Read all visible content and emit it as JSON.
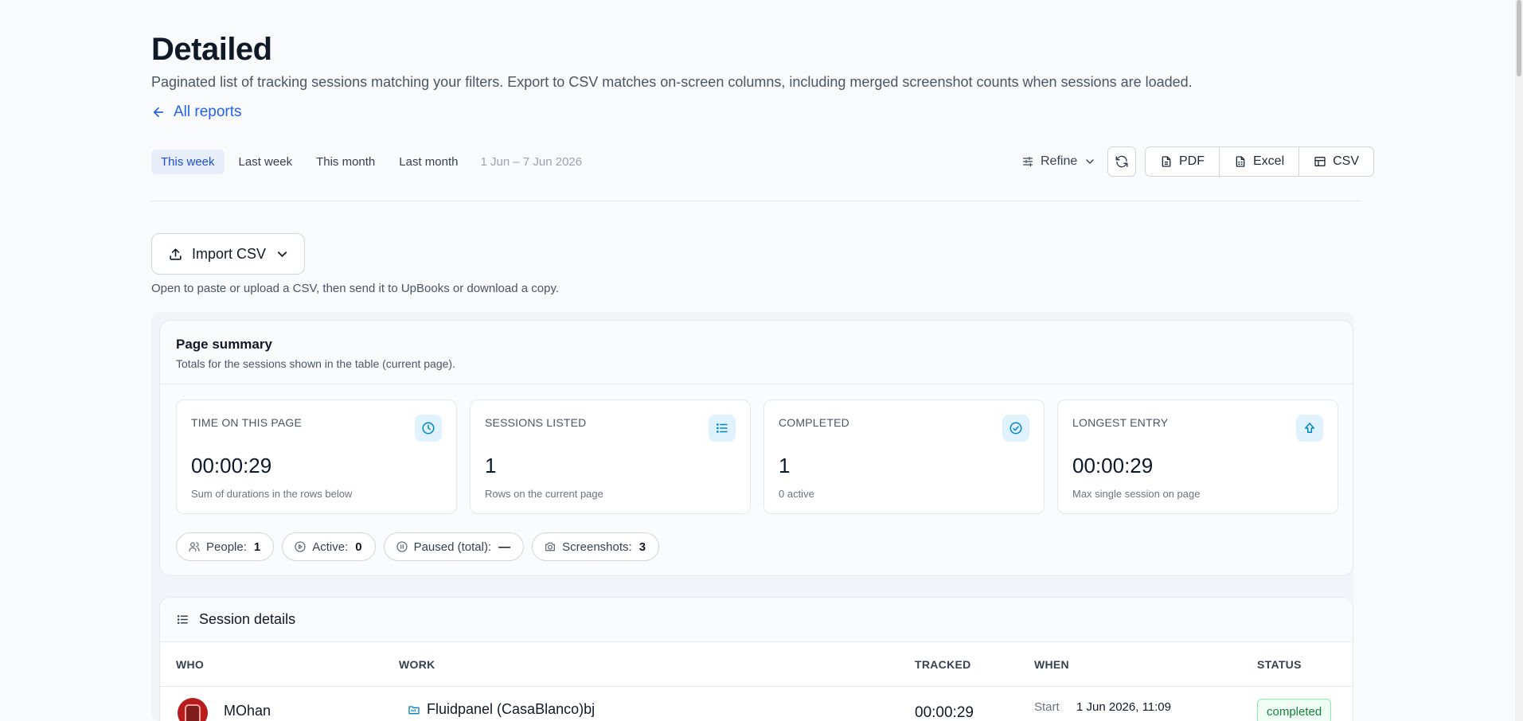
{
  "page": {
    "title": "Detailed",
    "subtitle": "Paginated list of tracking sessions matching your filters. Export to CSV matches on-screen columns, including merged screenshot counts when sessions are loaded.",
    "back_link": "All reports"
  },
  "toolbar": {
    "ranges": [
      "This week",
      "Last week",
      "This month",
      "Last month"
    ],
    "active_range": "This week",
    "date_span": "1 Jun – 7 Jun 2026",
    "refine_label": "Refine",
    "export": {
      "pdf": "PDF",
      "excel": "Excel",
      "csv": "CSV"
    }
  },
  "import": {
    "label": "Import CSV",
    "hint": "Open to paste or upload a CSV, then send it to UpBooks or download a copy."
  },
  "summary": {
    "title": "Page summary",
    "subtitle": "Totals for the sessions shown in the table (current page).",
    "metrics": [
      {
        "label": "TIME ON THIS PAGE",
        "value": "00:00:29",
        "note": "Sum of durations in the rows below",
        "icon": "clock-icon"
      },
      {
        "label": "SESSIONS LISTED",
        "value": "1",
        "note": "Rows on the current page",
        "icon": "list-icon"
      },
      {
        "label": "COMPLETED",
        "value": "1",
        "note": "0 active",
        "icon": "check-circle-icon"
      },
      {
        "label": "LONGEST ENTRY",
        "value": "00:00:29",
        "note": "Max single session on page",
        "icon": "arrow-up-icon"
      }
    ],
    "chips": [
      {
        "label": "People:",
        "value": "1",
        "icon": "people-icon"
      },
      {
        "label": "Active:",
        "value": "0",
        "icon": "play-circle-icon"
      },
      {
        "label": "Paused (total):",
        "value": "—",
        "icon": "pause-circle-icon"
      },
      {
        "label": "Screenshots:",
        "value": "3",
        "icon": "camera-icon"
      }
    ]
  },
  "sessions": {
    "title": "Session details",
    "columns": {
      "who": "WHO",
      "work": "WORK",
      "tracked": "TRACKED",
      "when": "WHEN",
      "status": "STATUS"
    },
    "rows": [
      {
        "who": "MOhan",
        "work": "Fluidpanel (CasaBlanco)bj",
        "tracked": "00:00:29",
        "when_label": "Start",
        "when_value": "1 Jun 2026, 11:09",
        "status": "completed"
      }
    ]
  },
  "colors": {
    "accent": "#2563eb",
    "icon_accent": "#0284c7",
    "status_completed": "#15803d"
  }
}
